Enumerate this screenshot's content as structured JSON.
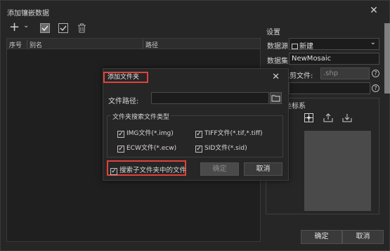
{
  "window": {
    "title": "添加镶嵌数据",
    "close_glyph": "✕"
  },
  "toolbar": {
    "add_glyph": "+",
    "add_dropdown_glyph": "⌄"
  },
  "table": {
    "columns": [
      "序号",
      "别名",
      "路径"
    ]
  },
  "settings": {
    "section_title": "设置",
    "source_label": "数据源:",
    "source_value": "新建",
    "source_dropdown_glyph": "⌄",
    "dataset_label": "数据集:",
    "dataset_value": "NewMosaic",
    "clip_label": "裁剪文件:",
    "clip_value": ".shp",
    "help_glyph": "?",
    "coord_label": "坐标系"
  },
  "footer": {
    "ok_label": "确定",
    "cancel_label": "取消"
  },
  "dialog": {
    "title": "添加文件夹",
    "close_glyph": "✕",
    "path_label": "文件路径:",
    "path_value": "",
    "group_title": "文件夹搜索文件类型",
    "check_glyph": "✓",
    "types": [
      {
        "label": "IMG文件(*.img)",
        "checked": true
      },
      {
        "label": "TIFF文件(*.tif,*.tiff)",
        "checked": true
      },
      {
        "label": "ECW文件(*.ecw)",
        "checked": true
      },
      {
        "label": "SID文件(*.sid)",
        "checked": true
      }
    ],
    "subfolder_label": "搜索子文件夹中的文件",
    "subfolder_checked": true,
    "ok_label": "确定",
    "cancel_label": "取消"
  },
  "colors": {
    "highlight": "#e0413c",
    "window_bg": "#262626",
    "table_bg": "#1f1f1f"
  }
}
